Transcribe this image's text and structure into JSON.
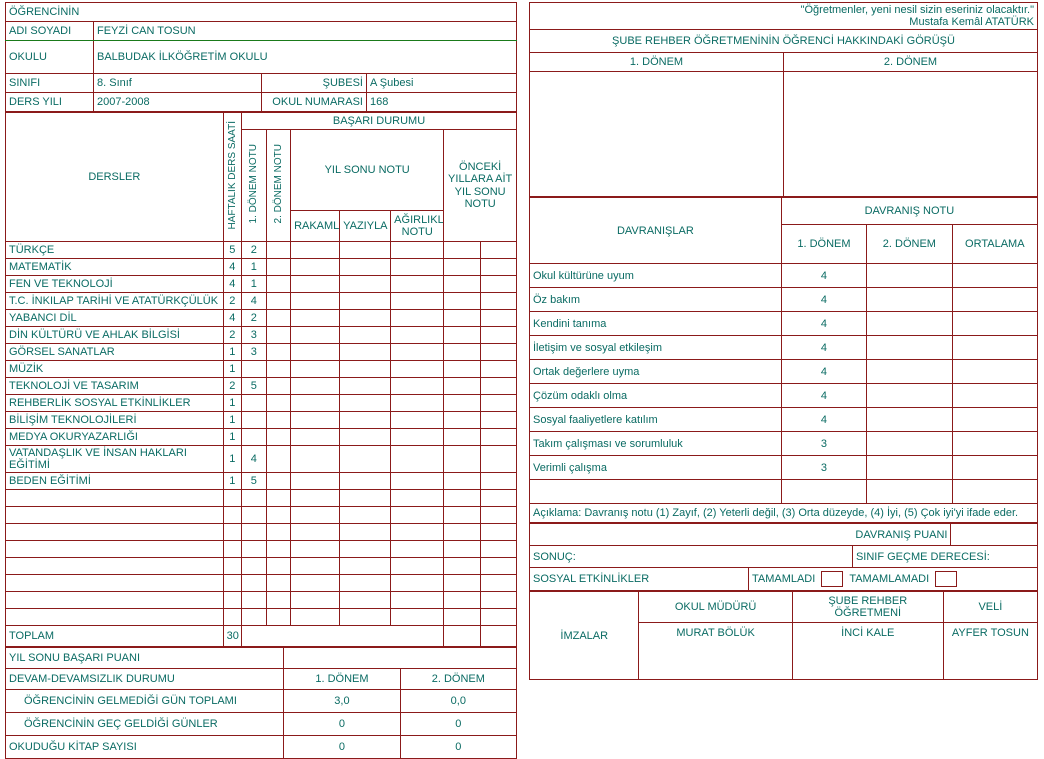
{
  "student_info": {
    "header_label": "ÖĞRENCİNİN",
    "name_label": "ADI SOYADI",
    "name_value": "FEYZİ CAN  TOSUN",
    "school_label": "OKULU",
    "school_value": "BALBUDAK İLKÖĞRETİM OKULU",
    "class_label": "SINIFI",
    "class_value": "8. Sınıf",
    "section_label": "ŞUBESİ",
    "section_value": "A Şubesi",
    "year_label": "DERS YILI",
    "year_value": "2007-2008",
    "school_no_label": "OKUL NUMARASI",
    "school_no_value": "168"
  },
  "grades_table": {
    "subjects_header": "DERSLER",
    "achievement_header": "BAŞARI DURUMU",
    "weekly_hours_header": "HAFTALIK DERS SAATİ",
    "term1_header": "1. DÖNEM NOTU",
    "term2_header": "2. DÖNEM NOTU",
    "yearend_header": "YIL SONU NOTU",
    "numeric_header": "RAKAMLA",
    "written_header": "YAZIYLA",
    "weighted_header": "AĞIRLIKLI NOTU",
    "previous_years_header": "ÖNCEKİ YILLARA AİT YIL SONU NOTU",
    "rows": [
      {
        "subject": "TÜRKÇE",
        "hours": "5",
        "term1": "2",
        "term2": "",
        "rakamla": "",
        "yaziyla": "",
        "agirlikli": "",
        "prev1": "",
        "prev2": ""
      },
      {
        "subject": "MATEMATİK",
        "hours": "4",
        "term1": "1",
        "term2": "",
        "rakamla": "",
        "yaziyla": "",
        "agirlikli": "",
        "prev1": "",
        "prev2": ""
      },
      {
        "subject": "FEN VE TEKNOLOJİ",
        "hours": "4",
        "term1": "1",
        "term2": "",
        "rakamla": "",
        "yaziyla": "",
        "agirlikli": "",
        "prev1": "",
        "prev2": ""
      },
      {
        "subject": "T.C. İNKILAP TARİHİ VE ATATÜRKÇÜLÜK",
        "hours": "2",
        "term1": "4",
        "term2": "",
        "rakamla": "",
        "yaziyla": "",
        "agirlikli": "",
        "prev1": "",
        "prev2": ""
      },
      {
        "subject": "YABANCI DİL",
        "hours": "4",
        "term1": "2",
        "term2": "",
        "rakamla": "",
        "yaziyla": "",
        "agirlikli": "",
        "prev1": "",
        "prev2": ""
      },
      {
        "subject": "DİN KÜLTÜRÜ VE AHLAK BİLGİSİ",
        "hours": "2",
        "term1": "3",
        "term2": "",
        "rakamla": "",
        "yaziyla": "",
        "agirlikli": "",
        "prev1": "",
        "prev2": ""
      },
      {
        "subject": "GÖRSEL SANATLAR",
        "hours": "1",
        "term1": "3",
        "term2": "",
        "rakamla": "",
        "yaziyla": "",
        "agirlikli": "",
        "prev1": "",
        "prev2": ""
      },
      {
        "subject": "MÜZİK",
        "hours": "1",
        "term1": "",
        "term2": "",
        "rakamla": "",
        "yaziyla": "",
        "agirlikli": "",
        "prev1": "",
        "prev2": ""
      },
      {
        "subject": "TEKNOLOJİ VE TASARIM",
        "hours": "2",
        "term1": "5",
        "term2": "",
        "rakamla": "",
        "yaziyla": "",
        "agirlikli": "",
        "prev1": "",
        "prev2": ""
      },
      {
        "subject": "REHBERLİK SOSYAL ETKİNLİKLER",
        "hours": "1",
        "term1": "",
        "term2": "",
        "rakamla": "",
        "yaziyla": "",
        "agirlikli": "",
        "prev1": "",
        "prev2": ""
      },
      {
        "subject": "BİLİŞİM TEKNOLOJİLERİ",
        "hours": "1",
        "term1": "",
        "term2": "",
        "rakamla": "",
        "yaziyla": "",
        "agirlikli": "",
        "prev1": "",
        "prev2": ""
      },
      {
        "subject": "MEDYA OKURYAZARLIĞI",
        "hours": "1",
        "term1": "",
        "term2": "",
        "rakamla": "",
        "yaziyla": "",
        "agirlikli": "",
        "prev1": "",
        "prev2": ""
      },
      {
        "subject": "VATANDAŞLIK VE İNSAN HAKLARI EĞİTİMİ",
        "hours": "1",
        "term1": "4",
        "term2": "",
        "rakamla": "",
        "yaziyla": "",
        "agirlikli": "",
        "prev1": "",
        "prev2": ""
      },
      {
        "subject": "BEDEN EĞİTİMİ",
        "hours": "1",
        "term1": "5",
        "term2": "",
        "rakamla": "",
        "yaziyla": "",
        "agirlikli": "",
        "prev1": "",
        "prev2": ""
      },
      {
        "subject": "",
        "hours": "",
        "term1": "",
        "term2": "",
        "rakamla": "",
        "yaziyla": "",
        "agirlikli": "",
        "prev1": "",
        "prev2": ""
      },
      {
        "subject": "",
        "hours": "",
        "term1": "",
        "term2": "",
        "rakamla": "",
        "yaziyla": "",
        "agirlikli": "",
        "prev1": "",
        "prev2": ""
      },
      {
        "subject": "",
        "hours": "",
        "term1": "",
        "term2": "",
        "rakamla": "",
        "yaziyla": "",
        "agirlikli": "",
        "prev1": "",
        "prev2": ""
      },
      {
        "subject": "",
        "hours": "",
        "term1": "",
        "term2": "",
        "rakamla": "",
        "yaziyla": "",
        "agirlikli": "",
        "prev1": "",
        "prev2": ""
      },
      {
        "subject": "",
        "hours": "",
        "term1": "",
        "term2": "",
        "rakamla": "",
        "yaziyla": "",
        "agirlikli": "",
        "prev1": "",
        "prev2": ""
      },
      {
        "subject": "",
        "hours": "",
        "term1": "",
        "term2": "",
        "rakamla": "",
        "yaziyla": "",
        "agirlikli": "",
        "prev1": "",
        "prev2": ""
      },
      {
        "subject": "",
        "hours": "",
        "term1": "",
        "term2": "",
        "rakamla": "",
        "yaziyla": "",
        "agirlikli": "",
        "prev1": "",
        "prev2": ""
      },
      {
        "subject": "",
        "hours": "",
        "term1": "",
        "term2": "",
        "rakamla": "",
        "yaziyla": "",
        "agirlikli": "",
        "prev1": "",
        "prev2": ""
      }
    ],
    "total_label": "TOPLAM",
    "total_hours": "30"
  },
  "summary": {
    "yearend_score_label": "YIL SONU BAŞARI PUANI",
    "yearend_score_value": "",
    "attendance_label": "DEVAM-DEVAMSIZLIK DURUMU",
    "term1_label": "1. DÖNEM",
    "term2_label": "2. DÖNEM",
    "rows": [
      {
        "label": "ÖĞRENCİNİN GELMEDİĞİ GÜN TOPLAMI",
        "term1": "3,0",
        "term2": "0,0"
      },
      {
        "label": "ÖĞRENCİNİN GEÇ GELDİĞİ GÜNLER",
        "term1": "0",
        "term2": "0"
      }
    ],
    "books_label": "OKUDUĞU KİTAP SAYISI",
    "books_term1": "0",
    "books_term2": "0"
  },
  "right": {
    "quote_line1": "\"Öğretmenler, yeni nesil sizin eseriniz olacaktır.\"",
    "quote_line2": "Mustafa Kemâl ATATÜRK",
    "opinion_header": "ŞUBE REHBER ÖĞRETMENİNİN ÖĞRENCİ HAKKINDAKİ GÖRÜŞÜ",
    "opinion_term1": "1. DÖNEM",
    "opinion_term2": "2. DÖNEM",
    "opinion_text1": "",
    "opinion_text2": "",
    "behaviors_header": "DAVRANIŞLAR",
    "behavior_grade_header": "DAVRANIŞ NOTU",
    "behavior_term1": "1. DÖNEM",
    "behavior_term2": "2. DÖNEM",
    "behavior_average": "ORTALAMA",
    "behavior_rows": [
      {
        "label": "Okul kültürüne uyum",
        "term1": "4",
        "term2": "",
        "avg": ""
      },
      {
        "label": "Öz bakım",
        "term1": "4",
        "term2": "",
        "avg": ""
      },
      {
        "label": "Kendini tanıma",
        "term1": "4",
        "term2": "",
        "avg": ""
      },
      {
        "label": "İletişim  ve sosyal etkileşim",
        "term1": "4",
        "term2": "",
        "avg": ""
      },
      {
        "label": "Ortak değerlere uyma",
        "term1": "4",
        "term2": "",
        "avg": ""
      },
      {
        "label": "Çözüm odaklı olma",
        "term1": "4",
        "term2": "",
        "avg": ""
      },
      {
        "label": "Sosyal faaliyetlere katılım",
        "term1": "4",
        "term2": "",
        "avg": ""
      },
      {
        "label": "Takım çalışması ve sorumluluk",
        "term1": "3",
        "term2": "",
        "avg": ""
      },
      {
        "label": "Verimli çalışma",
        "term1": "3",
        "term2": "",
        "avg": ""
      },
      {
        "label": "",
        "term1": "",
        "term2": "",
        "avg": ""
      }
    ],
    "explanation": "Açıklama: Davranış notu (1) Zayıf, (2) Yeterli değil, (3) Orta düzeyde, (4) İyi, (5) Çok iyi'yi ifade eder.",
    "behavior_score_label": "DAVRANIŞ PUANI",
    "behavior_score_value": "",
    "result_label": "SONUÇ:",
    "result_value": "",
    "promotion_label": "SINIF GEÇME DERECESİ:",
    "promotion_value": "",
    "social_label": "SOSYAL ETKİNLİKLER",
    "completed_label": "TAMAMLADI",
    "not_completed_label": "TAMAMLAMADI",
    "signatures_label": "İMZALAR",
    "principal_label": "OKUL MÜDÜRÜ",
    "principal_name": "MURAT BÖLÜK",
    "counselor_label": "ŞUBE REHBER ÖĞRETMENİ",
    "counselor_name": "İNCİ KALE",
    "parent_label": "VELİ",
    "parent_name": "AYFER TOSUN"
  },
  "colors": {
    "border": "#8b1a1a",
    "label_text": "#0a6b63",
    "value_text": "#12147a",
    "green_divider": "#1a7a1a"
  }
}
